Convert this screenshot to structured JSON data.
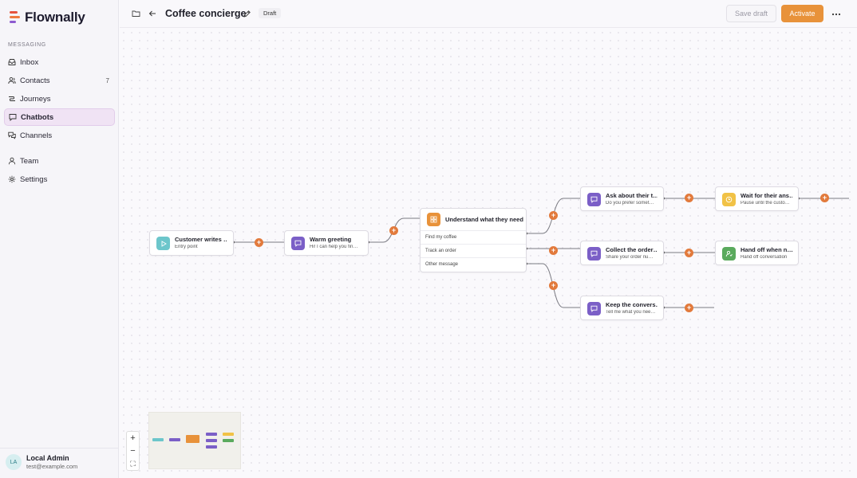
{
  "app": {
    "name": "Flownally"
  },
  "sidebar": {
    "section_label": "MESSAGING",
    "items": [
      {
        "label": "Inbox",
        "icon": "inbox-icon",
        "count": ""
      },
      {
        "label": "Contacts",
        "icon": "contacts-icon",
        "count": "7"
      },
      {
        "label": "Journeys",
        "icon": "journeys-icon",
        "count": ""
      },
      {
        "label": "Chatbots",
        "icon": "chatbot-icon",
        "count": "",
        "active": true
      },
      {
        "label": "Channels",
        "icon": "channels-icon",
        "count": ""
      },
      {
        "label": "Team",
        "icon": "team-icon",
        "count": ""
      },
      {
        "label": "Settings",
        "icon": "gear-icon",
        "count": ""
      }
    ],
    "user": {
      "initials": "LA",
      "name": "Local Admin",
      "email": "test@example.com"
    }
  },
  "topbar": {
    "title": "Coffee concierge",
    "status_badge": "Draft",
    "save_label": "Save draft",
    "activate_label": "Activate"
  },
  "colors": {
    "accent": "#e8923a",
    "plus": "#e27a3c",
    "trigger": "#6cc6cb",
    "message": "#7b5fc7",
    "condition": "#e8923a",
    "wait": "#f1c246",
    "handoff": "#5aaa5d"
  },
  "nodes": {
    "trigger": {
      "title": "Customer writes …",
      "sub": "Entry point"
    },
    "greeting": {
      "title": "Warm greeting",
      "sub": "Hi! I can help you fin…"
    },
    "understand": {
      "title": "Understand what they need",
      "options": [
        "Find my coffee",
        "Track an order",
        "Other message"
      ]
    },
    "ask": {
      "title": "Ask about their t…",
      "sub": "Do you prefer somet…"
    },
    "collect": {
      "title": "Collect the order…",
      "sub": "Share your order nu…"
    },
    "keep": {
      "title": "Keep the convers…",
      "sub": "Tell me what you nee…"
    },
    "wait": {
      "title": "Wait for their ans…",
      "sub": "Pause until the custo…"
    },
    "handoff": {
      "title": "Hand off when n…",
      "sub": "Hand off conversation"
    }
  },
  "zoom_controls": {
    "zoom_in": "+",
    "zoom_out": "−",
    "fit": "⛶"
  }
}
